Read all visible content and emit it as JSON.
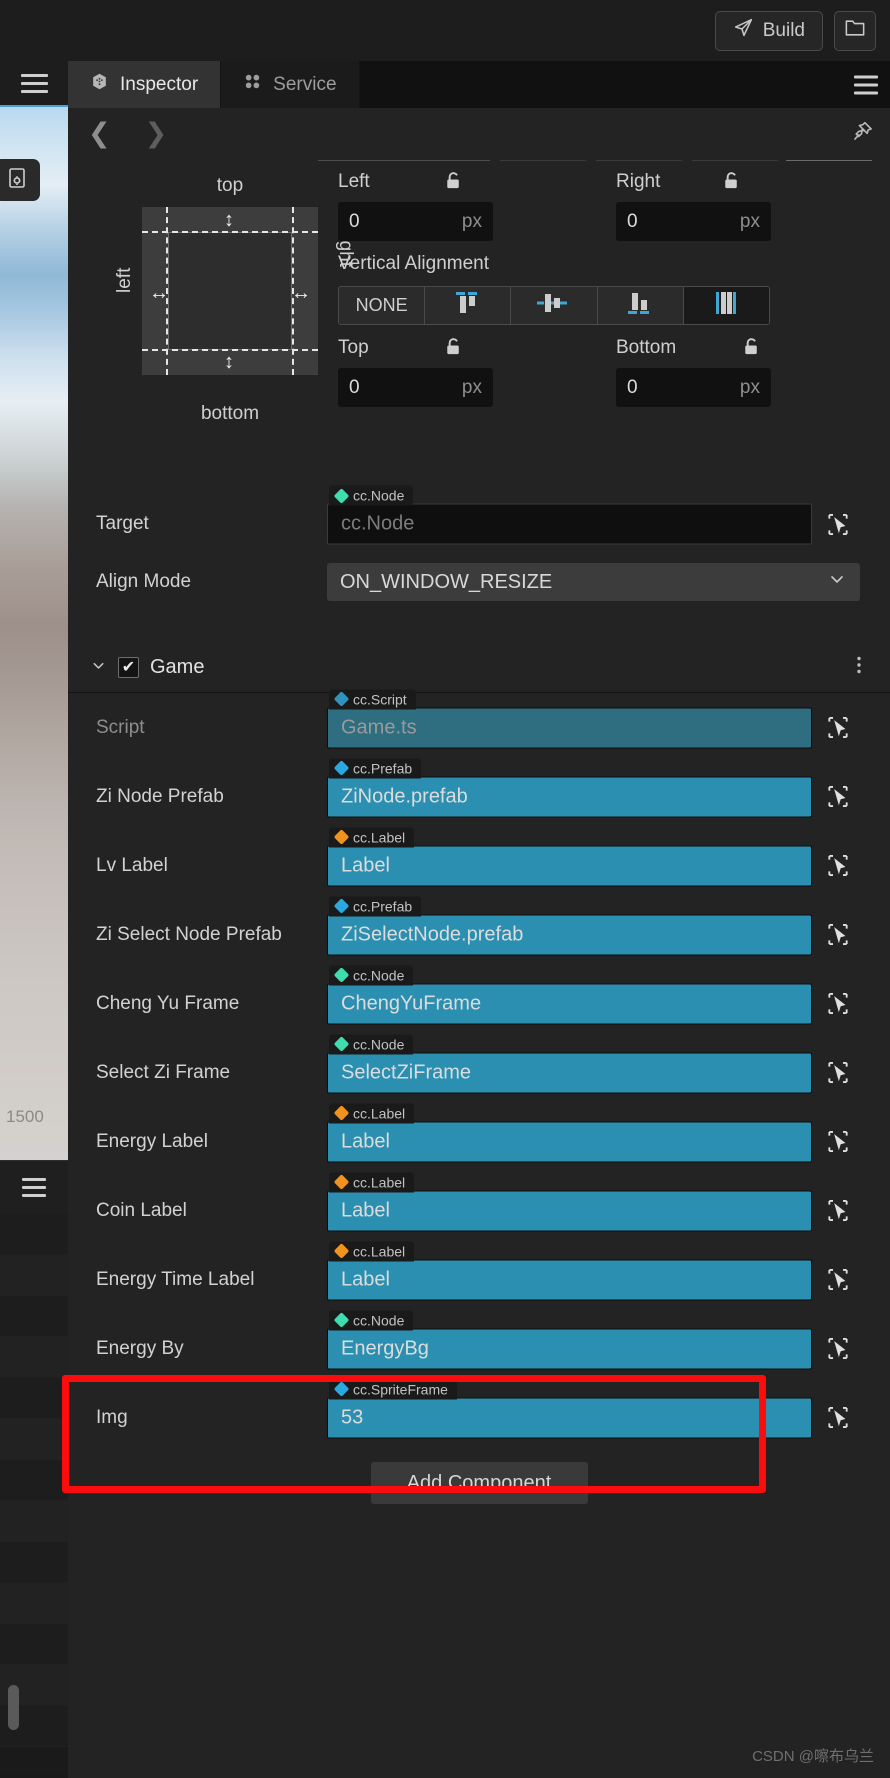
{
  "toolbar": {
    "build_label": "Build",
    "build_icon": "send-icon",
    "folder_icon": "folder-icon"
  },
  "left_strip": {
    "menu_icon": "hamburger-icon",
    "tool_icon": "node-settings-icon",
    "ruler_label": "1500",
    "bottom_menu_icon": "hamburger-icon"
  },
  "panel": {
    "tabs": [
      {
        "label": "Inspector",
        "icon": "inspector-icon",
        "active": true
      },
      {
        "label": "Service",
        "icon": "service-icon",
        "active": false
      }
    ],
    "panel_menu_icon": "hamburger-icon",
    "nav": {
      "back_icon": "chevron-left-icon",
      "forward_icon": "chevron-right-icon",
      "pin_icon": "pin-icon"
    }
  },
  "widget": {
    "diagram": {
      "top_label": "top",
      "bottom_label": "bottom",
      "left_label": "left",
      "right_label": "right"
    },
    "left": {
      "label": "Left",
      "value": "0",
      "unit": "px",
      "lock_icon": "unlock-icon"
    },
    "right": {
      "label": "Right",
      "value": "0",
      "unit": "px",
      "lock_icon": "unlock-icon"
    },
    "top": {
      "label": "Top",
      "value": "0",
      "unit": "px",
      "lock_icon": "unlock-icon"
    },
    "bottom": {
      "label": "Bottom",
      "value": "0",
      "unit": "px",
      "lock_icon": "unlock-icon"
    },
    "vertical_alignment": {
      "label": "Vertical Alignment",
      "options": [
        {
          "label": "NONE",
          "icon": "align-none",
          "selected": false
        },
        {
          "label": "",
          "icon": "align-top-icon",
          "selected": false
        },
        {
          "label": "",
          "icon": "align-middle-icon",
          "selected": false
        },
        {
          "label": "",
          "icon": "align-bottom-icon",
          "selected": false
        },
        {
          "label": "",
          "icon": "align-stretch-icon",
          "selected": true
        }
      ]
    },
    "target": {
      "label": "Target",
      "type": "cc.Node",
      "value": "cc.Node",
      "empty": true,
      "badge_color": "#3fdcad",
      "picker_icon": "locate-icon"
    },
    "align_mode": {
      "label": "Align Mode",
      "value": "ON_WINDOW_RESIZE",
      "chevron_icon": "chevron-down-icon"
    }
  },
  "component": {
    "title": "Game",
    "checked": true,
    "collapse_icon": "chevron-down-icon",
    "menu_icon": "kebab-menu-icon",
    "properties": [
      {
        "label": "Script",
        "type": "cc.Script",
        "value": "Game.ts",
        "badge_color": "#2f93bd",
        "locked": true,
        "lock_icon": "lock-icon",
        "disabled": true,
        "picker_icon": "locate-icon"
      },
      {
        "label": "Zi Node Prefab",
        "type": "cc.Prefab",
        "value": "ZiNode.prefab",
        "badge_color": "#2aa8e0",
        "locked": false,
        "disabled": false,
        "picker_icon": "locate-icon"
      },
      {
        "label": "Lv Label",
        "type": "cc.Label",
        "value": "Label",
        "badge_color": "#f0931e",
        "locked": false,
        "disabled": false,
        "picker_icon": "locate-icon"
      },
      {
        "label": "Zi Select Node Prefab",
        "type": "cc.Prefab",
        "value": "ZiSelectNode.prefab",
        "badge_color": "#2aa8e0",
        "locked": false,
        "disabled": false,
        "picker_icon": "locate-icon"
      },
      {
        "label": "Cheng Yu Frame",
        "type": "cc.Node",
        "value": "ChengYuFrame",
        "badge_color": "#3fdcad",
        "locked": false,
        "disabled": false,
        "picker_icon": "locate-icon"
      },
      {
        "label": "Select Zi Frame",
        "type": "cc.Node",
        "value": "SelectZiFrame",
        "badge_color": "#3fdcad",
        "locked": false,
        "disabled": false,
        "picker_icon": "locate-icon"
      },
      {
        "label": "Energy Label",
        "type": "cc.Label",
        "value": "Label",
        "badge_color": "#f0931e",
        "locked": false,
        "disabled": false,
        "picker_icon": "locate-icon"
      },
      {
        "label": "Coin Label",
        "type": "cc.Label",
        "value": "Label",
        "badge_color": "#f0931e",
        "locked": false,
        "disabled": false,
        "picker_icon": "locate-icon"
      },
      {
        "label": "Energy Time Label",
        "type": "cc.Label",
        "value": "Label",
        "badge_color": "#f0931e",
        "locked": false,
        "disabled": false,
        "picker_icon": "locate-icon"
      },
      {
        "label": "Energy By",
        "type": "cc.Node",
        "value": "EnergyBg",
        "badge_color": "#3fdcad",
        "locked": false,
        "disabled": false,
        "picker_icon": "locate-icon"
      },
      {
        "label": "Img",
        "type": "cc.SpriteFrame",
        "value": "53",
        "badge_color": "#2aa8e0",
        "locked": false,
        "disabled": false,
        "picker_icon": "locate-icon"
      }
    ]
  },
  "add_component": {
    "label": "Add Component"
  },
  "annotation": {
    "highlight_color": "#fc0d0d"
  },
  "watermark": {
    "text": "CSDN @嚓布乌兰"
  }
}
